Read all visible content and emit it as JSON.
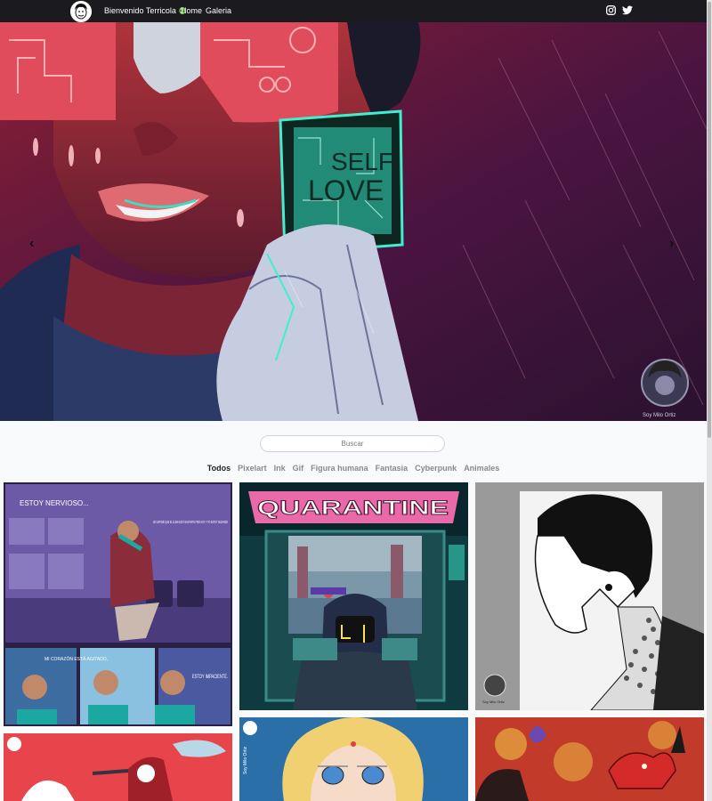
{
  "nav": {
    "brand_text": "Bienvenido Terricola",
    "links": [
      "Home",
      "Galeria"
    ],
    "social": [
      "instagram-icon",
      "twitter-icon"
    ]
  },
  "hero": {
    "sign_text_1": "SELF",
    "sign_text_2": "LOVE",
    "signature": "Soy Milo Ortiz",
    "prev_label": "‹",
    "next_label": "›"
  },
  "search": {
    "placeholder": "Buscar"
  },
  "filters": [
    "Todos",
    "Pixelart",
    "Ink",
    "Gif",
    "Figura humana",
    "Fantasia",
    "Cyberpunk",
    "Animales"
  ],
  "gallery": {
    "comic": {
      "bubble_1": "ESTOY NERVIOSO...",
      "bubble_2": "SE SUPONE QUE EL CLIMA ESTÁ BASTANTE FRIO HOY, Y YO ESTOY SUDANDO",
      "bubble_3": "MI CORAZÓN ESTÁ AGITADO,",
      "bubble_4": "ESTOY IMPACIENTE."
    },
    "arcade": {
      "marquee": "QUARANTINE"
    },
    "portrait": {
      "signature": "Soy Milo Ortiz"
    },
    "tile5": {
      "signature": "Soy Milo Ortiz"
    }
  },
  "colors": {
    "navbar": "#1b1b1f",
    "page_bg": "#f8fafc",
    "filter_active": "#222222",
    "filter_inactive": "#8a8a8a"
  }
}
